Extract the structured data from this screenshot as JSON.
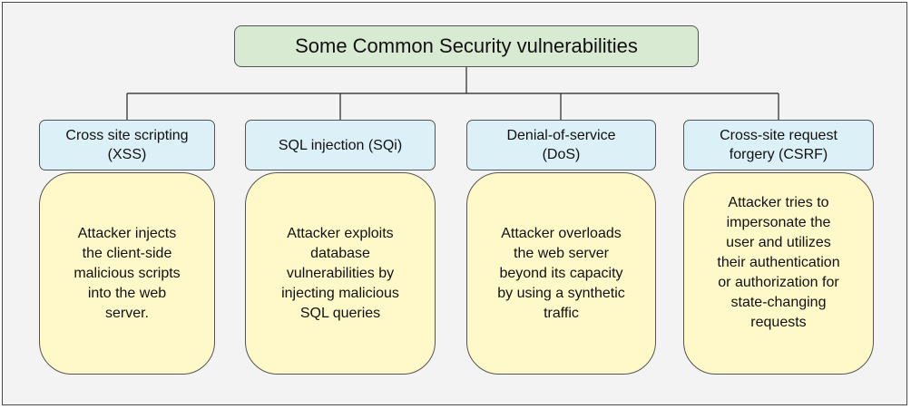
{
  "diagram": {
    "title": "Some Common Security vulnerabilities",
    "colors": {
      "background": "#f3f3f3",
      "title_fill": "#d9ead3",
      "category_fill": "#dcf0f7",
      "description_fill": "#fff9c9",
      "border": "#555555"
    },
    "categories": [
      {
        "label": "Cross site scripting\n(XSS)",
        "description": "Attacker injects\nthe client-side\nmalicious scripts\ninto the web\nserver."
      },
      {
        "label": "SQL injection (SQi)",
        "description": "Attacker exploits\ndatabase\nvulnerabilities by\ninjecting malicious\nSQL queries"
      },
      {
        "label": "Denial-of-service\n(DoS)",
        "description": "Attacker overloads\nthe web server\nbeyond its capacity\nby using a synthetic\ntraffic"
      },
      {
        "label": "Cross-site request\nforgery (CSRF)",
        "description": "Attacker tries to\nimpersonate the\nuser and utilizes\ntheir authentication\nor authorization for\nstate-changing\nrequests"
      }
    ]
  }
}
